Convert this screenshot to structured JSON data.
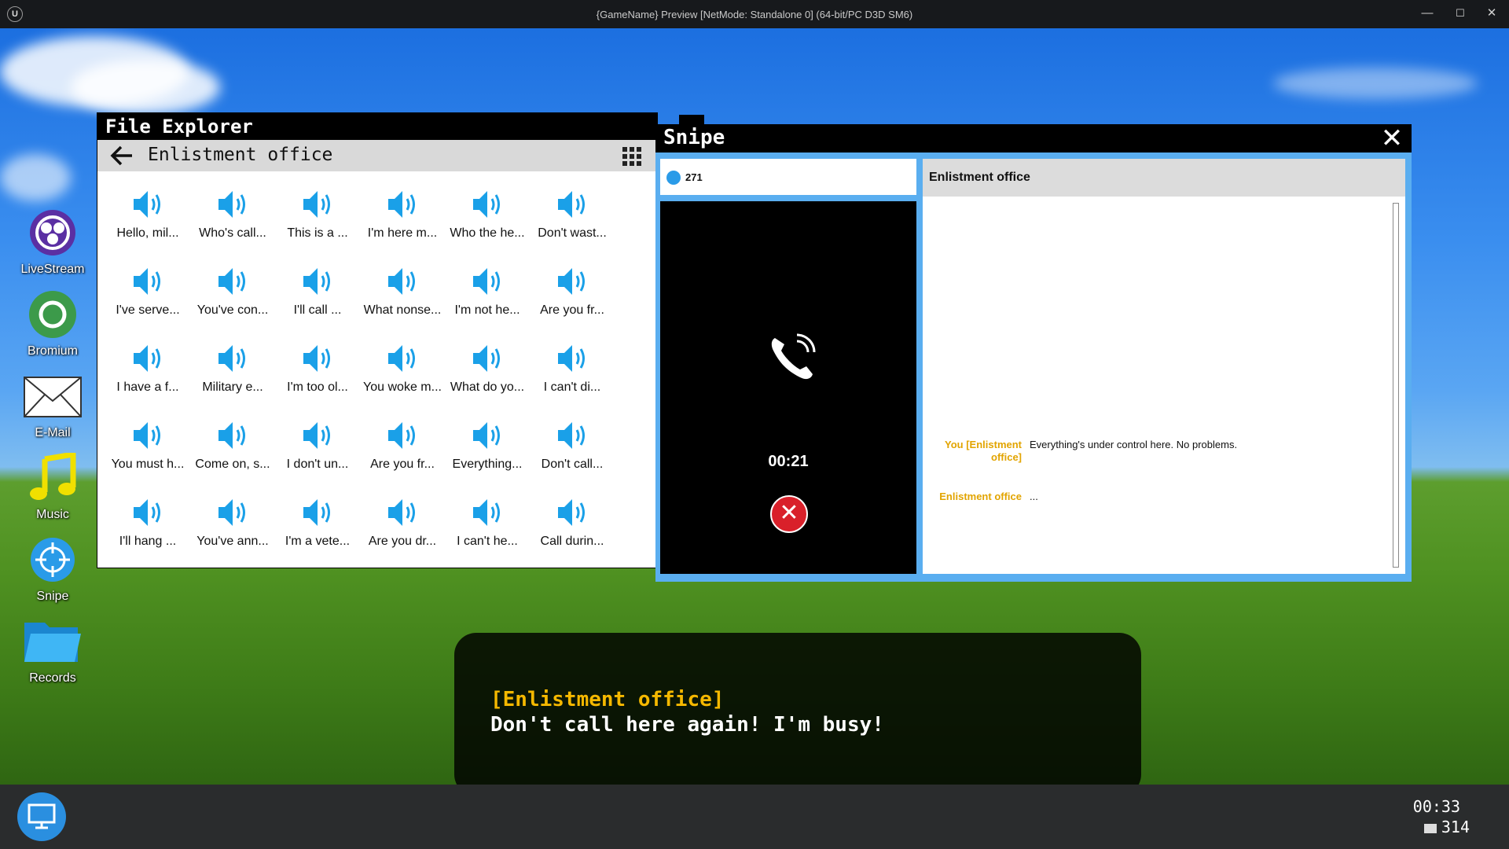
{
  "window": {
    "title": "{GameName} Preview [NetMode: Standalone 0]  (64-bit/PC D3D SM6)",
    "controls": [
      "—",
      "☐",
      "✕"
    ]
  },
  "desktop_icons": [
    {
      "label": "LiveStream",
      "icon": "livestream-icon"
    },
    {
      "label": "Bromium",
      "icon": "browser-icon"
    },
    {
      "label": "E-Mail",
      "icon": "mail-icon"
    },
    {
      "label": "Music",
      "icon": "music-icon"
    },
    {
      "label": "Snipe",
      "icon": "snipe-icon"
    },
    {
      "label": "Records",
      "icon": "folder-icon"
    }
  ],
  "file_explorer": {
    "title": "File Explorer",
    "path": "Enlistment office",
    "files": [
      "Hello, mil...",
      "Who's call...",
      "This is a ...",
      "I'm here m...",
      "Who the he...",
      "Don't wast...",
      "I've serve...",
      "You've con...",
      "I'll call ...",
      "What nonse...",
      "I'm not he...",
      "Are you fr...",
      "I have a f...",
      "Military e...",
      "I'm too ol...",
      "You woke m...",
      "What do yo...",
      "I can't di...",
      "You must h...",
      "Come on, s...",
      "I don't un...",
      "Are you fr...",
      "Everything...",
      "Don't call...",
      "I'll hang ...",
      "You've ann...",
      "I'm a vete...",
      "Are you dr...",
      "I can't he...",
      "Call durin..."
    ]
  },
  "snipe": {
    "title": "Snipe",
    "close": "✕",
    "contact_number": "271",
    "call_timer": "00:21",
    "hangup": "✕",
    "chat_header": "Enlistment office",
    "messages": [
      {
        "who": "You [Enlistment office]",
        "text": "Everything's under control here. No problems."
      },
      {
        "who": "Enlistment office",
        "text": "..."
      }
    ]
  },
  "subtitle": {
    "speaker": "[Enlistment office]",
    "line": "Don't call here again! I'm busy!"
  },
  "taskbar": {
    "time": "00:33",
    "coins": "314"
  },
  "colors": {
    "accent": "#5aaef0",
    "speaker_yellow": "#f5b800",
    "icon_blue": "#1aa0e8",
    "hangup_red": "#d9202a"
  }
}
